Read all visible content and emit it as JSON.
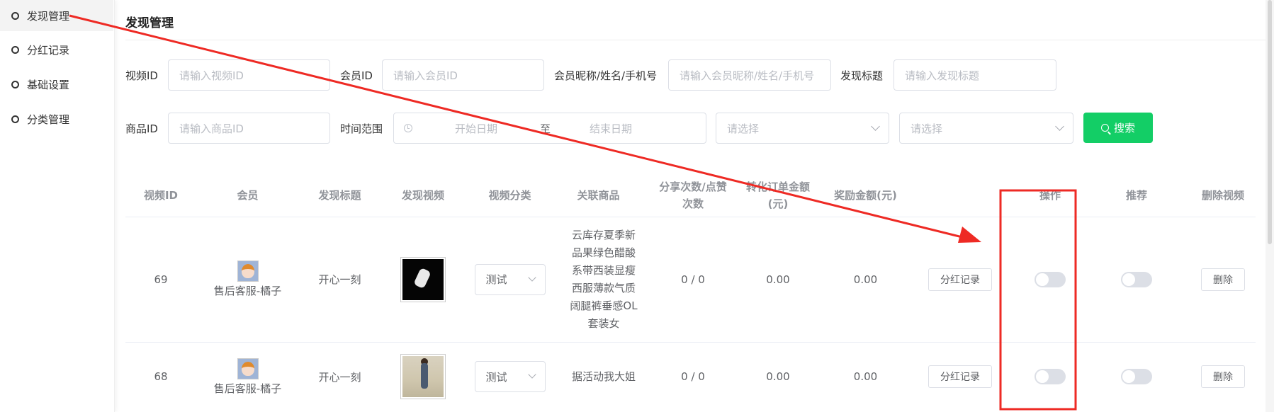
{
  "sidebar": {
    "items": [
      {
        "label": "发现管理",
        "active": true
      },
      {
        "label": "分红记录",
        "active": false
      },
      {
        "label": "基础设置",
        "active": false
      },
      {
        "label": "分类管理",
        "active": false
      }
    ]
  },
  "page": {
    "title": "发现管理"
  },
  "filters": {
    "video_id": {
      "label": "视频ID",
      "placeholder": "请输入视频ID"
    },
    "member_id": {
      "label": "会员ID",
      "placeholder": "请输入会员ID"
    },
    "member_name": {
      "label": "会员昵称/姓名/手机号",
      "placeholder": "请输入会员昵称/姓名/手机号"
    },
    "title": {
      "label": "发现标题",
      "placeholder": "请输入发现标题"
    },
    "goods_id": {
      "label": "商品ID",
      "placeholder": "请输入商品ID"
    },
    "time_range": {
      "label": "时间范围",
      "start_placeholder": "开始日期",
      "separator": "至",
      "end_placeholder": "结束日期"
    },
    "select1": {
      "placeholder": "请选择"
    },
    "select2": {
      "placeholder": "请选择"
    },
    "search_label": "搜索"
  },
  "table": {
    "headers": [
      "视频ID",
      "会员",
      "发现标题",
      "发现视频",
      "视频分类",
      "关联商品",
      "分享次数/点赞次数",
      "转化订单金额(元)",
      "奖励金额(元)",
      "",
      "操作",
      "推荐",
      "删除视频"
    ],
    "rows": [
      {
        "video_id": "69",
        "member": "售后客服-橘子",
        "title": "开心一刻",
        "category": "测试",
        "goods": "云库存夏季新品果绿色醋酸系带西装显瘦西服薄款气质阔腿裤垂感OL套装女",
        "share_like": "0 / 0",
        "order_amount": "0.00",
        "reward": "0.00",
        "record_btn": "分红记录",
        "op_on": false,
        "recommend_on": false,
        "delete_btn": "删除"
      },
      {
        "video_id": "68",
        "member": "售后客服-橘子",
        "title": "开心一刻",
        "category": "测试",
        "goods": "据活动我大姐",
        "share_like": "0 / 0",
        "order_amount": "0.00",
        "reward": "0.00",
        "record_btn": "分红记录",
        "op_on": false,
        "recommend_on": false,
        "delete_btn": "删除"
      }
    ]
  },
  "annotation": {
    "color": "#ee2a24"
  }
}
